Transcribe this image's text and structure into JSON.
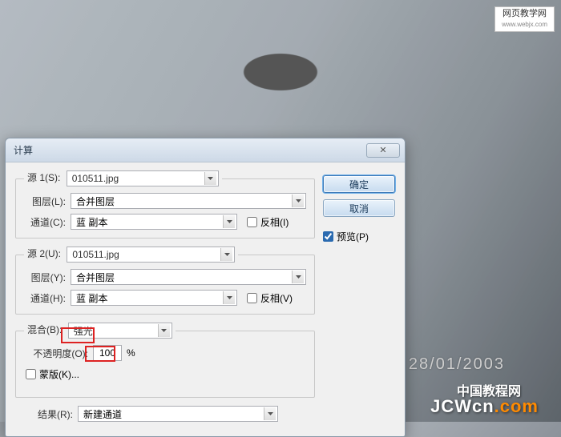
{
  "watermarks": {
    "top_label": "网页教学网",
    "top_url": "www.webjx.com",
    "date": "28/01/2003",
    "cn_tutorial": "中国教程网",
    "site": "JCWcn",
    "site_suffix": ".com"
  },
  "dialog": {
    "title": "计算",
    "buttons": {
      "ok": "确定",
      "cancel": "取消"
    },
    "preview_label": "预览(P)",
    "preview_checked": true,
    "source1": {
      "legend": "源 1(S):",
      "file": "010511.jpg",
      "layer_label": "图层(L):",
      "layer": "合并图层",
      "channel_label": "通道(C):",
      "channel": "蓝 副本",
      "invert_label": "反相(I)",
      "invert_checked": false
    },
    "source2": {
      "legend": "源 2(U):",
      "file": "010511.jpg",
      "layer_label": "图层(Y):",
      "layer": "合并图层",
      "channel_label": "通道(H):",
      "channel": "蓝 副本",
      "invert_label": "反相(V)",
      "invert_checked": false
    },
    "blend": {
      "label": "混合(B):",
      "mode": "强光"
    },
    "opacity": {
      "label": "不透明度(O):",
      "value": "100",
      "suffix": "%"
    },
    "mask": {
      "label": "蒙版(K)...",
      "checked": false
    },
    "result": {
      "label": "结果(R):",
      "value": "新建通道"
    }
  }
}
